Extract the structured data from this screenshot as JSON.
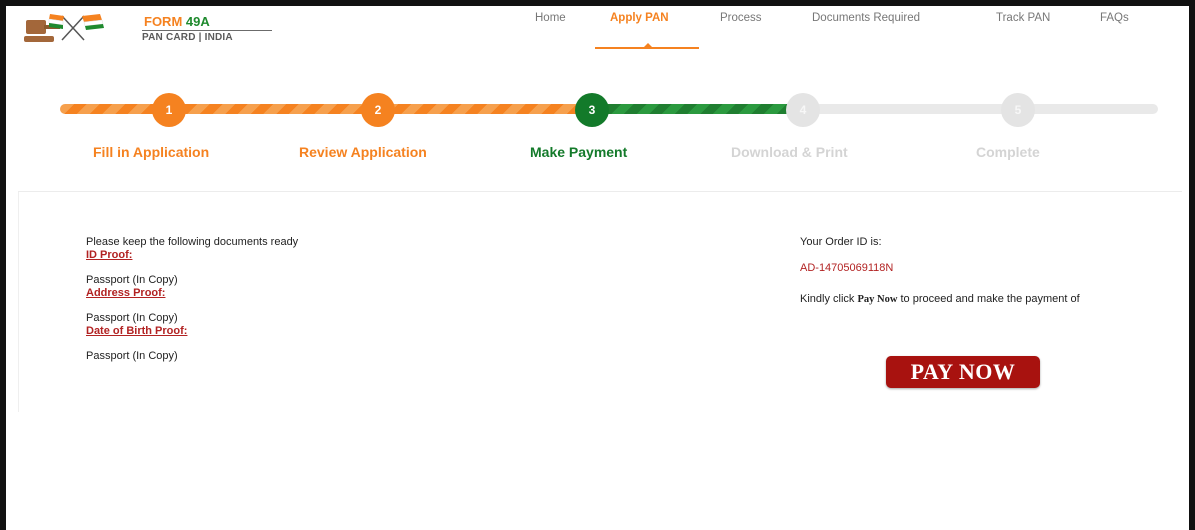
{
  "brand": {
    "form_word": "FORM",
    "form_number": "49A",
    "subtitle": "PAN CARD | INDIA",
    "logo_icon": "gavel-flags-logo"
  },
  "nav": {
    "items": [
      {
        "label": "Home",
        "active": false
      },
      {
        "label": "Apply PAN",
        "active": true
      },
      {
        "label": "Process",
        "active": false
      },
      {
        "label": "Documents Required",
        "active": false
      },
      {
        "label": "Track PAN",
        "active": false
      },
      {
        "label": "FAQs",
        "active": false
      }
    ]
  },
  "steps": [
    {
      "number": "1",
      "label": "Fill in Application",
      "state": "done"
    },
    {
      "number": "2",
      "label": "Review Application",
      "state": "done"
    },
    {
      "number": "3",
      "label": "Make Payment",
      "state": "current"
    },
    {
      "number": "4",
      "label": "Download & Print",
      "state": "pending"
    },
    {
      "number": "5",
      "label": "Complete",
      "state": "pending"
    }
  ],
  "documents": {
    "intro": "Please keep the following documents ready",
    "id_proof_heading": "ID Proof:",
    "id_proof_value": "Passport (In Copy)",
    "address_proof_heading": "Address Proof:",
    "address_proof_value": "Passport (In Copy)",
    "dob_proof_heading": "Date of Birth Proof:",
    "dob_proof_value": "Passport (In Copy)"
  },
  "order": {
    "label": "Your Order ID is:",
    "id": "AD-14705069118N",
    "message_before": "Kindly click ",
    "message_emphasis": "Pay Now",
    "message_after": " to proceed and make the payment of",
    "pay_button": "PAY NOW"
  },
  "colors": {
    "accent_orange": "#f58220",
    "accent_green": "#137a2a",
    "heading_red": "#b22222",
    "pay_button": "#a8120f"
  }
}
